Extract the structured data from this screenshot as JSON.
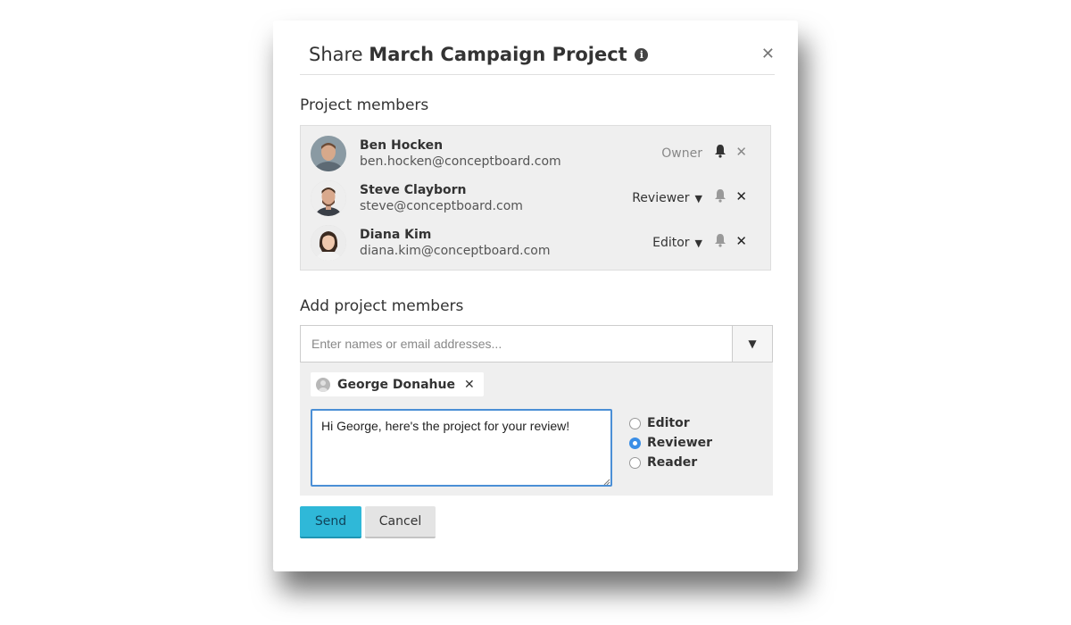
{
  "dialog": {
    "title_prefix": "Share",
    "project_name": "March Campaign Project",
    "info_icon": "info-icon",
    "close_icon": "close-icon"
  },
  "members_section": {
    "title": "Project members",
    "members": [
      {
        "name": "Ben Hocken",
        "email": "ben.hocken@conceptboard.com",
        "role": "Owner",
        "role_editable": false
      },
      {
        "name": "Steve Clayborn",
        "email": "steve@conceptboard.com",
        "role": "Reviewer",
        "role_editable": true
      },
      {
        "name": "Diana Kim",
        "email": "diana.kim@conceptboard.com",
        "role": "Editor",
        "role_editable": true
      }
    ]
  },
  "add_section": {
    "title": "Add project members",
    "search_placeholder": "Enter names or email addresses...",
    "selected_chip": "George Donahue",
    "message": "Hi George, here's the project for your review!",
    "role_options": [
      {
        "label": "Editor",
        "selected": false
      },
      {
        "label": "Reviewer",
        "selected": true
      },
      {
        "label": "Reader",
        "selected": false
      }
    ]
  },
  "buttons": {
    "send": "Send",
    "cancel": "Cancel"
  },
  "colors": {
    "send_button": "#2fb8d8",
    "focus_border": "#4b8fd6",
    "radio_selected": "#3a8ee6"
  }
}
